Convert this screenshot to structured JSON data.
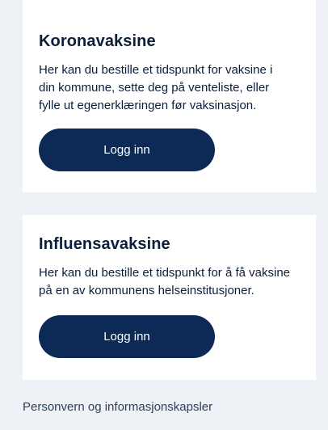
{
  "cards": [
    {
      "title": "Koronavaksine",
      "text_lines": [
        "Her kan du bestille et tidspunkt for vaksine i",
        "din kommune, sette deg på venteliste, eller",
        "fylle ut egenerklæringen før vaksinasjon."
      ],
      "button_label": "Logg inn"
    },
    {
      "title": "Influensavaksine",
      "text_lines": [
        "Her kan du bestille et tidspunkt for å få vaksine",
        "på en av kommunens helseinstitusjoner."
      ],
      "button_label": "Logg inn"
    }
  ],
  "footer": {
    "link_label": "Personvern og informasjonskapsler"
  },
  "colors": {
    "page_background": "#eef2f6",
    "card_background": "#ffffff",
    "button_background": "#0d2a57",
    "text": "#0b1f3a"
  }
}
